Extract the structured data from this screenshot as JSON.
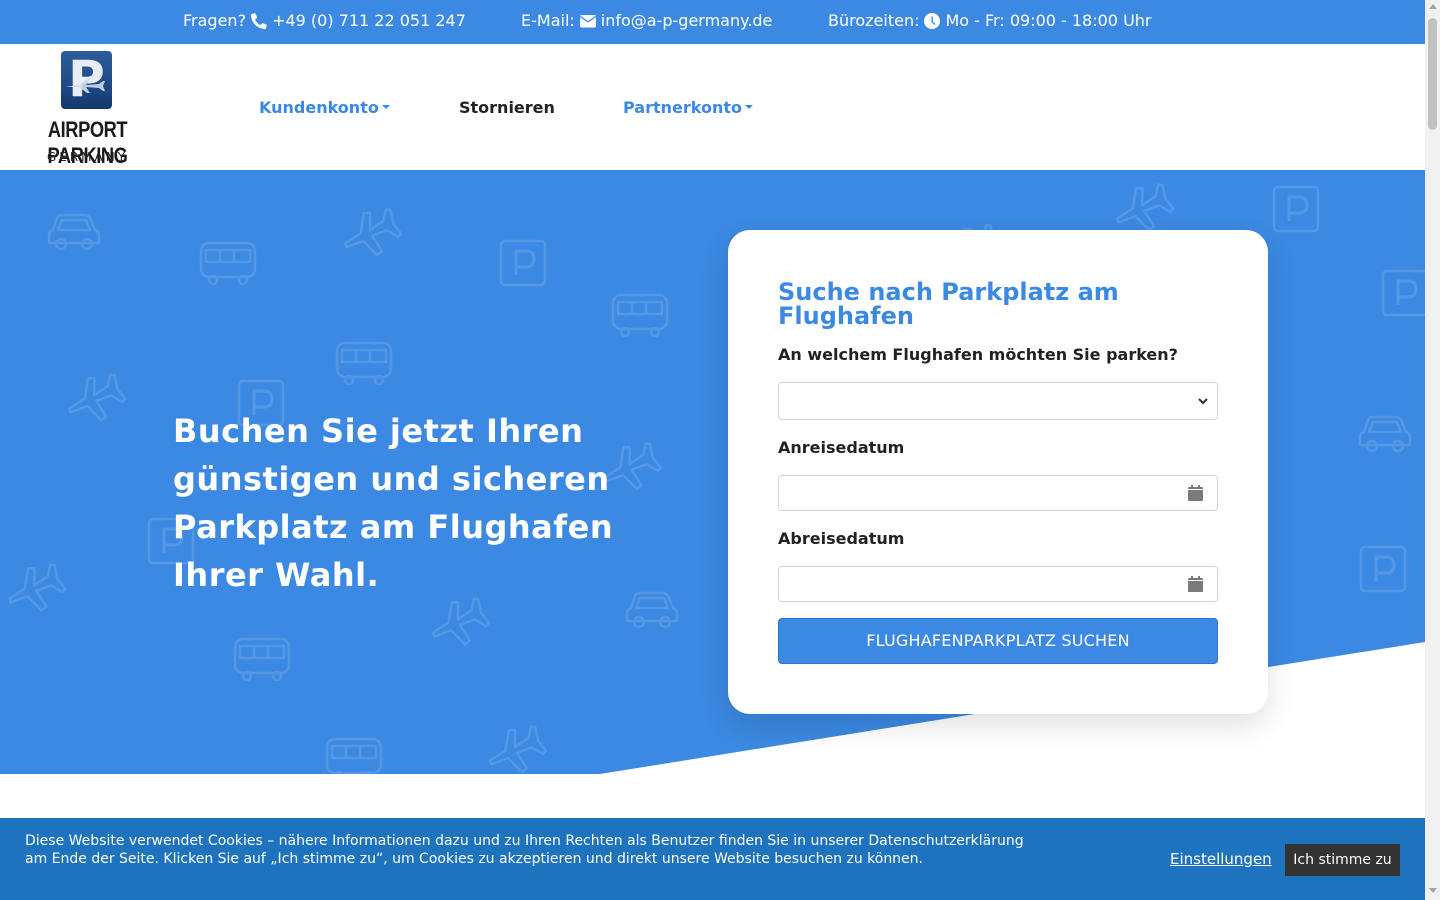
{
  "colors": {
    "brand": "#3b89e2",
    "cookie_bar": "#1e73be",
    "accept_button": "#333333"
  },
  "topbar": {
    "phone_label": "Fragen?",
    "phone_icon": "phone-icon",
    "phone": "+49 (0) 711 22 051 247",
    "email_label": "E-Mail:",
    "email_icon": "envelope-icon",
    "email": "info@a-p-germany.de",
    "hours_label": "Bürozeiten:",
    "hours_icon": "clock-icon",
    "hours": "Mo - Fr: 09:00 - 18:00 Uhr"
  },
  "logo": {
    "letter": "P",
    "name": "AIRPORT PARKING",
    "sub": "GERMANY"
  },
  "nav": {
    "customer": "Kundenkonto",
    "cancel": "Stornieren",
    "partner": "Partnerkonto"
  },
  "hero": {
    "headline": "Buchen Sie jetzt Ihren günstigen und sicheren Parkplatz am Flughafen Ihrer Wahl.",
    "pattern_icons": [
      "car-icon",
      "bus-icon",
      "plane-icon",
      "parking-sign-icon"
    ]
  },
  "search": {
    "title": "Suche nach Parkplatz am Flughafen",
    "airport_label": "An welchem Flughafen möchten Sie parken?",
    "airport_value": "",
    "arrival_label": "Anreisedatum",
    "arrival_value": "",
    "departure_label": "Abreisedatum",
    "departure_value": "",
    "submit": "FLUGHAFENPARKPLATZ SUCHEN"
  },
  "cookie": {
    "text": "Diese Website verwendet Cookies – nähere Informationen dazu und zu Ihren Rechten als Benutzer finden Sie in unserer Datenschutzerklärung am Ende der Seite. Klicken Sie auf „Ich stimme zu“, um Cookies zu akzeptieren und direkt unsere Website besuchen zu können.",
    "settings": "Einstellungen",
    "accept": "Ich stimme zu"
  }
}
